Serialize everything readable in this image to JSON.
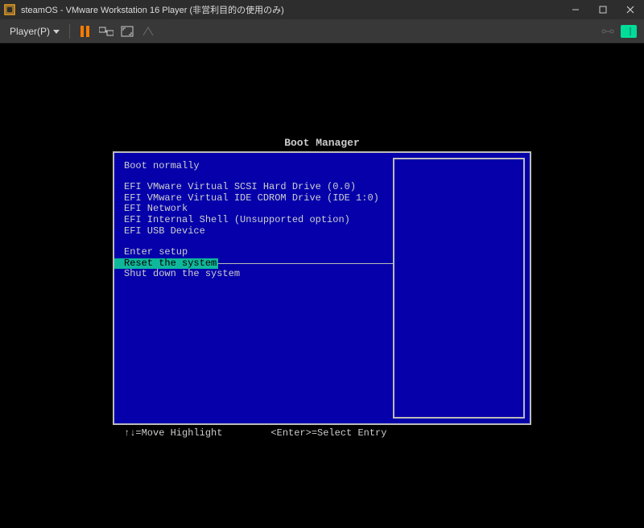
{
  "window": {
    "title": "steamOS - VMware Workstation 16 Player (非営利目的の使用のみ)"
  },
  "toolbar": {
    "player_menu_label": "Player(P)"
  },
  "boot": {
    "title": "Boot Manager",
    "items": [
      "Boot normally",
      "",
      "EFI VMware Virtual SCSI Hard Drive (0.0)",
      "EFI VMware Virtual IDE CDROM Drive (IDE 1:0)",
      "EFI Network",
      "EFI Internal Shell (Unsupported option)",
      "EFI USB Device",
      "",
      "Enter setup",
      "Reset the system",
      "Shut down the system"
    ],
    "selected_index": 9,
    "footer": {
      "move": "↑↓=Move Highlight",
      "select": "<Enter>=Select Entry"
    }
  }
}
